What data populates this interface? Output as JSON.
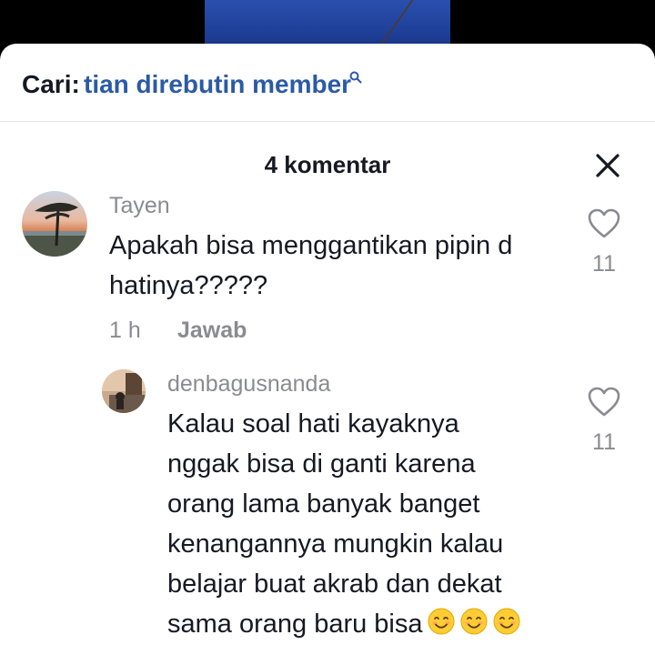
{
  "search": {
    "label": "Cari:",
    "query": "tian direbutin member"
  },
  "header": {
    "title": "4 komentar"
  },
  "comments": [
    {
      "username": "Tayen",
      "text_lines": [
        "Apakah bisa menggantikan pipin d",
        "hatinya?????"
      ],
      "time": "1 h",
      "reply_label": "Jawab",
      "likes": "11"
    }
  ],
  "replies": [
    {
      "username": "denbagusnanda",
      "text_lines": [
        "Kalau soal hati kayaknya",
        "nggak bisa di ganti karena",
        "orang lama banyak banget",
        "kenangannya mungkin kalau",
        "belajar buat akrab dan dekat",
        "sama orang baru bisa"
      ],
      "emoji_count": 3,
      "likes": "11"
    }
  ],
  "icons": {
    "search": "search-icon",
    "close": "close-icon",
    "like": "heart-outline-icon",
    "emoji": "smiling-face-emoji"
  },
  "colors": {
    "search_query": "#2b5aa6",
    "muted_text": "#8a8b91",
    "primary_text": "#161823",
    "divider": "#e6e6e8"
  }
}
